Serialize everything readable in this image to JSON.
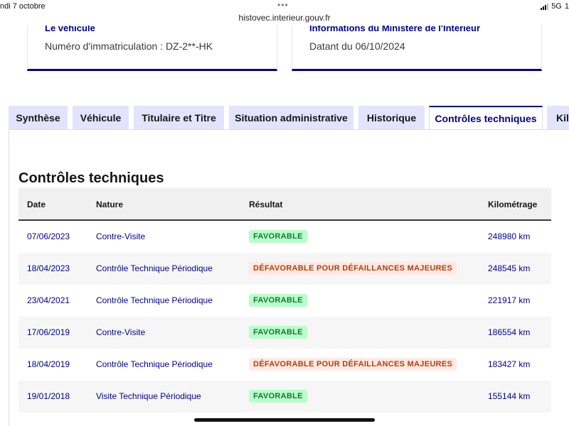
{
  "status_bar": {
    "time": "ndi 7 octobre",
    "url": "histovec.interieur.gouv.fr",
    "dots": "•••",
    "network": "5G",
    "battery": "1"
  },
  "cards": [
    {
      "title": "Le véhicule",
      "text": "Numéro d'immatriculation : DZ-2**-HK"
    },
    {
      "title": "Informations du Ministère de l'Intérieur",
      "text": "Datant du 06/10/2024"
    }
  ],
  "tabs": [
    {
      "label": "Synthèse"
    },
    {
      "label": "Véhicule"
    },
    {
      "label": "Titulaire et Titre"
    },
    {
      "label": "Situation administrative"
    },
    {
      "label": "Historique"
    },
    {
      "label": "Contrôles techniques"
    },
    {
      "label": "Kilo"
    }
  ],
  "active_tab_index": 5,
  "section": {
    "title": "Contrôles techniques"
  },
  "table": {
    "headers": {
      "date": "Date",
      "nature": "Nature",
      "result": "Résultat",
      "km": "Kilométrage"
    },
    "rows": [
      {
        "date": "07/06/2023",
        "nature": "Contre-Visite",
        "result": "FAVORABLE",
        "km": "248980 km"
      },
      {
        "date": "18/04/2023",
        "nature": "Contrôle Technique Périodique",
        "result": "DÉFAVORABLE POUR DÉFAILLANCES MAJEURES",
        "km": "248545 km"
      },
      {
        "date": "23/04/2021",
        "nature": "Contrôle Technique Périodique",
        "result": "FAVORABLE",
        "km": "221917 km"
      },
      {
        "date": "17/06/2019",
        "nature": "Contre-Visite",
        "result": "FAVORABLE",
        "km": "186554 km"
      },
      {
        "date": "18/04/2019",
        "nature": "Contrôle Technique Périodique",
        "result": "DÉFAVORABLE POUR DÉFAILLANCES MAJEURES",
        "km": "183427 km"
      },
      {
        "date": "19/01/2018",
        "nature": "Visite Technique Périodique",
        "result": "FAVORABLE",
        "km": "155144 km"
      }
    ]
  },
  "colors": {
    "accent": "#000091",
    "favorable_bg": "#b8fec9",
    "favorable_text": "#18753c",
    "defavorable_bg": "#ffe9e6",
    "defavorable_text": "#b34000",
    "tab_bg": "#e3e3fd"
  }
}
